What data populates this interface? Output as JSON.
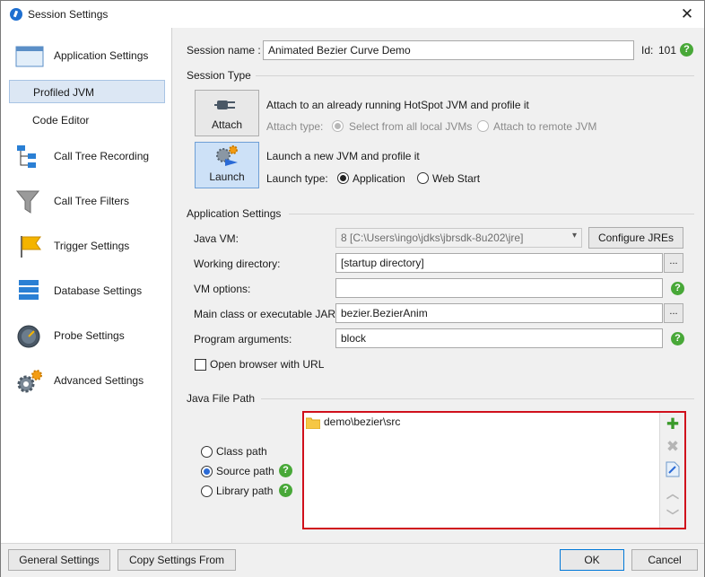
{
  "window": {
    "title": "Session Settings",
    "close_glyph": "✕"
  },
  "sidebar": {
    "items": [
      {
        "label": "Application Settings",
        "icon": "window-icon"
      },
      {
        "label": "Profiled JVM",
        "selected": true
      },
      {
        "label": "Code Editor"
      },
      {
        "label": "Call Tree Recording",
        "icon": "call-tree-icon"
      },
      {
        "label": "Call Tree Filters",
        "icon": "funnel-icon"
      },
      {
        "label": "Trigger Settings",
        "icon": "flag-icon"
      },
      {
        "label": "Database Settings",
        "icon": "database-icon"
      },
      {
        "label": "Probe Settings",
        "icon": "gauge-icon"
      },
      {
        "label": "Advanced Settings",
        "icon": "gears-icon"
      }
    ]
  },
  "session": {
    "name_label": "Session name :",
    "name_value": "Animated Bezier Curve Demo",
    "id_label": "Id:",
    "id_value": "101"
  },
  "session_type": {
    "title": "Session Type",
    "attach_button": "Attach",
    "attach_desc": "Attach to an already running HotSpot JVM and profile it",
    "attach_type_label": "Attach type:",
    "attach_opt_local": "Select from all local JVMs",
    "attach_opt_remote": "Attach to remote JVM",
    "launch_button": "Launch",
    "launch_desc": "Launch a new JVM and profile it",
    "launch_type_label": "Launch type:",
    "launch_opt_app": "Application",
    "launch_opt_web": "Web Start"
  },
  "app_settings": {
    "title": "Application Settings",
    "java_vm_label": "Java VM:",
    "java_vm_value": "8 [C:\\Users\\ingo\\jdks\\jbrsdk-8u202\\jre]",
    "configure_jres": "Configure JREs",
    "working_dir_label": "Working directory:",
    "working_dir_value": "[startup directory]",
    "vm_options_label": "VM options:",
    "vm_options_value": "",
    "main_class_label": "Main class or executable JAR:",
    "main_class_value": "bezier.BezierAnim",
    "program_args_label": "Program arguments:",
    "program_args_value": "block",
    "open_browser_label": "Open browser with URL",
    "browse_glyph": "..."
  },
  "java_file_path": {
    "title": "Java File Path",
    "class_path": "Class path",
    "source_path": "Source path",
    "library_path": "Library path",
    "entries": [
      "demo\\bezier\\src"
    ]
  },
  "footer": {
    "general_settings": "General Settings",
    "copy_settings_from": "Copy Settings From",
    "ok": "OK",
    "cancel": "Cancel"
  },
  "help_glyph": "?",
  "colors": {
    "highlight_border": "#d0101c",
    "help_green": "#48a838",
    "selection": "#dce7f4"
  }
}
